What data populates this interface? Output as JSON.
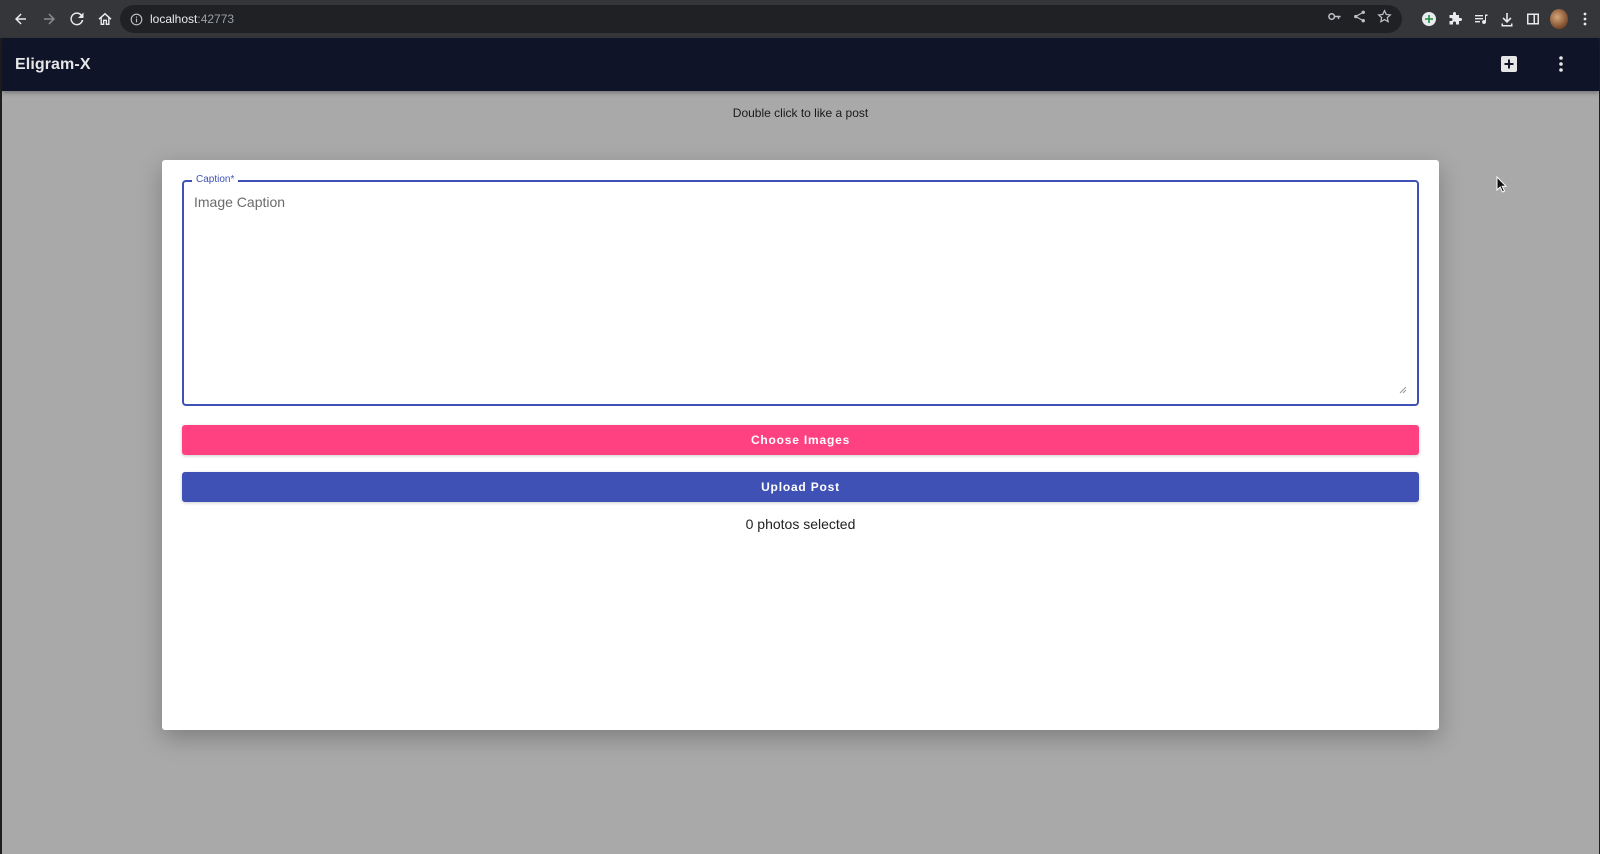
{
  "browser": {
    "url_host": "localhost",
    "url_port": ":42773"
  },
  "app": {
    "title": "Eligram-X",
    "hint": "Double click to like a post"
  },
  "dialog": {
    "caption_label": "Caption*",
    "caption_placeholder": "Image Caption",
    "caption_value": "",
    "choose_label": "Choose Images",
    "upload_label": "Upload Post",
    "selected_text": "0 photos selected"
  },
  "colors": {
    "appbar": "#0f1429",
    "primary": "#3f51b5",
    "accent": "#ff4081",
    "backdrop": "#a9a9a9"
  }
}
